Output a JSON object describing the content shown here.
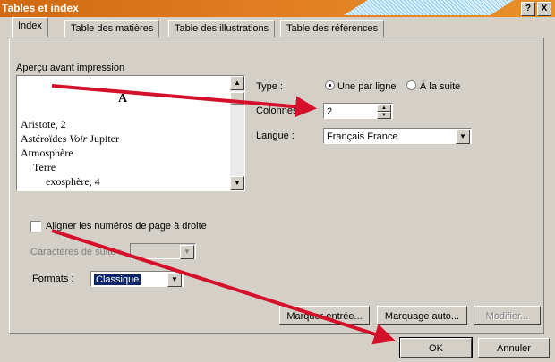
{
  "window": {
    "title": "Tables et index"
  },
  "titlebar_buttons": [
    "?",
    "X"
  ],
  "tabs": [
    {
      "label": "Index",
      "active": true
    },
    {
      "label": "Table des matières",
      "active": false
    },
    {
      "label": "Table des illustrations",
      "active": false
    },
    {
      "label": "Table des références",
      "active": false
    }
  ],
  "preview": {
    "label": "Aperçu avant impression",
    "heading": "A",
    "lines": [
      "Aristote, 2",
      "Astéroïdes Voir Jupiter",
      "Atmosphère",
      "Terre",
      "exosphère, 4"
    ]
  },
  "type": {
    "label": "Type :",
    "option1": "Une par ligne",
    "option2": "À la suite",
    "selected": "Une par ligne"
  },
  "columns": {
    "label": "Colonnes :",
    "value": "2"
  },
  "language": {
    "label": "Langue :",
    "value": "Français France"
  },
  "align": {
    "label": "Aligner les numéros de page à droite",
    "checked": false
  },
  "leader": {
    "label": "Caractères de suite :",
    "value": ""
  },
  "formats": {
    "label": "Formats :",
    "value": "Classique"
  },
  "buttons": {
    "mark_entry": "Marquer entrée...",
    "auto_mark": "Marquage auto...",
    "modify": "Modifier...",
    "ok": "OK",
    "cancel": "Annuler"
  },
  "colors": {
    "titlebar": "#d06a10",
    "annotation_arrow": "#d4102a",
    "selection": "#0a246a"
  }
}
